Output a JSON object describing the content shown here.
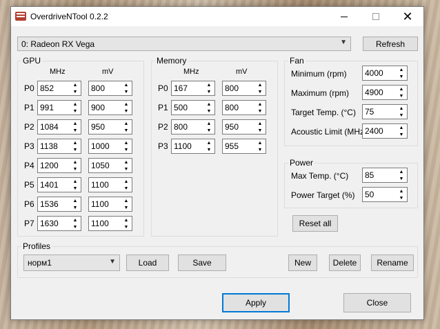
{
  "window": {
    "title": "OverdriveNTool 0.2.2",
    "close_glyph": "✕"
  },
  "device": {
    "selected": "0: Radeon RX Vega",
    "refresh_label": "Refresh"
  },
  "gpu": {
    "title": "GPU",
    "col_mhz": "MHz",
    "col_mv": "mV",
    "pstates": [
      {
        "label": "P0",
        "mhz": "852",
        "mv": "800"
      },
      {
        "label": "P1",
        "mhz": "991",
        "mv": "900"
      },
      {
        "label": "P2",
        "mhz": "1084",
        "mv": "950"
      },
      {
        "label": "P3",
        "mhz": "1138",
        "mv": "1000"
      },
      {
        "label": "P4",
        "mhz": "1200",
        "mv": "1050"
      },
      {
        "label": "P5",
        "mhz": "1401",
        "mv": "1100"
      },
      {
        "label": "P6",
        "mhz": "1536",
        "mv": "1100"
      },
      {
        "label": "P7",
        "mhz": "1630",
        "mv": "1100"
      }
    ]
  },
  "memory": {
    "title": "Memory",
    "col_mhz": "MHz",
    "col_mv": "mV",
    "pstates": [
      {
        "label": "P0",
        "mhz": "167",
        "mv": "800"
      },
      {
        "label": "P1",
        "mhz": "500",
        "mv": "800"
      },
      {
        "label": "P2",
        "mhz": "800",
        "mv": "950"
      },
      {
        "label": "P3",
        "mhz": "1100",
        "mv": "955"
      }
    ]
  },
  "fan": {
    "title": "Fan",
    "fields": [
      {
        "label": "Minimum (rpm)",
        "value": "4000"
      },
      {
        "label": "Maximum (rpm)",
        "value": "4900"
      },
      {
        "label": "Target Temp. (°C)",
        "value": "75"
      },
      {
        "label": "Acoustic Limit (MHz)",
        "value": "2400"
      }
    ]
  },
  "power": {
    "title": "Power",
    "fields": [
      {
        "label": "Max Temp. (°C)",
        "value": "85"
      },
      {
        "label": "Power Target (%)",
        "value": "50"
      }
    ]
  },
  "reset_all_label": "Reset all",
  "profiles": {
    "title": "Profiles",
    "selected": "норм1",
    "load_label": "Load",
    "save_label": "Save",
    "new_label": "New",
    "delete_label": "Delete",
    "rename_label": "Rename"
  },
  "footer": {
    "apply_label": "Apply",
    "close_label": "Close"
  }
}
